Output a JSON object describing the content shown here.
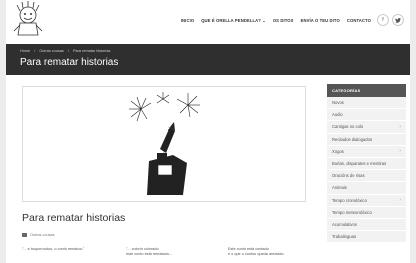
{
  "nav": {
    "items": [
      "INICIO",
      "QUE É ORELLA PENDELLA? ⌄",
      "OS DITOS",
      "ENVÍA O TEU DITO",
      "CONTACTO"
    ],
    "social": [
      {
        "icon": "facebook-icon",
        "glyph": "f"
      },
      {
        "icon": "twitter-icon",
        "glyph": "🐦"
      }
    ]
  },
  "breadcrumb": [
    "Home",
    "/",
    "Outras cousas",
    "/",
    "Para rematar historias"
  ],
  "page_title": "Para rematar historias",
  "post": {
    "title": "Para rematar historias",
    "category": "Outras cousas",
    "excerpt_col1": [
      "\"... e touporroutou, o conto rematou.\""
    ],
    "excerpt_col2": [
      "\"... colorín colorado",
      "este conto está rematado..."
    ],
    "excerpt_col3": [
      "Este conto está contado",
      "e o que o contou queda amolado."
    ]
  },
  "sidebar": {
    "heading": "CATEGORÍAS",
    "items": [
      {
        "label": "Novos",
        "chevron": false
      },
      {
        "label": "Audio",
        "chevron": false
      },
      {
        "label": "Cantigas no colo",
        "chevron": true
      },
      {
        "label": "Recitados dialogados",
        "chevron": false
      },
      {
        "label": "Xogos",
        "chevron": true
      },
      {
        "label": "Burlas, disparates e mentiras",
        "chevron": false
      },
      {
        "label": "Oracións de risas",
        "chevron": false
      },
      {
        "label": "Animais",
        "chevron": false
      },
      {
        "label": "Tempo cronolóxico",
        "chevron": true
      },
      {
        "label": "Tempo meteorolóxico",
        "chevron": false
      },
      {
        "label": "Acumulativos",
        "chevron": false
      },
      {
        "label": "Trabalinguas",
        "chevron": false
      }
    ]
  },
  "colors": {
    "title_bar": "#2f2f2f",
    "sidebar_head": "#555555",
    "sidebar_item": "#f2f2f2"
  }
}
